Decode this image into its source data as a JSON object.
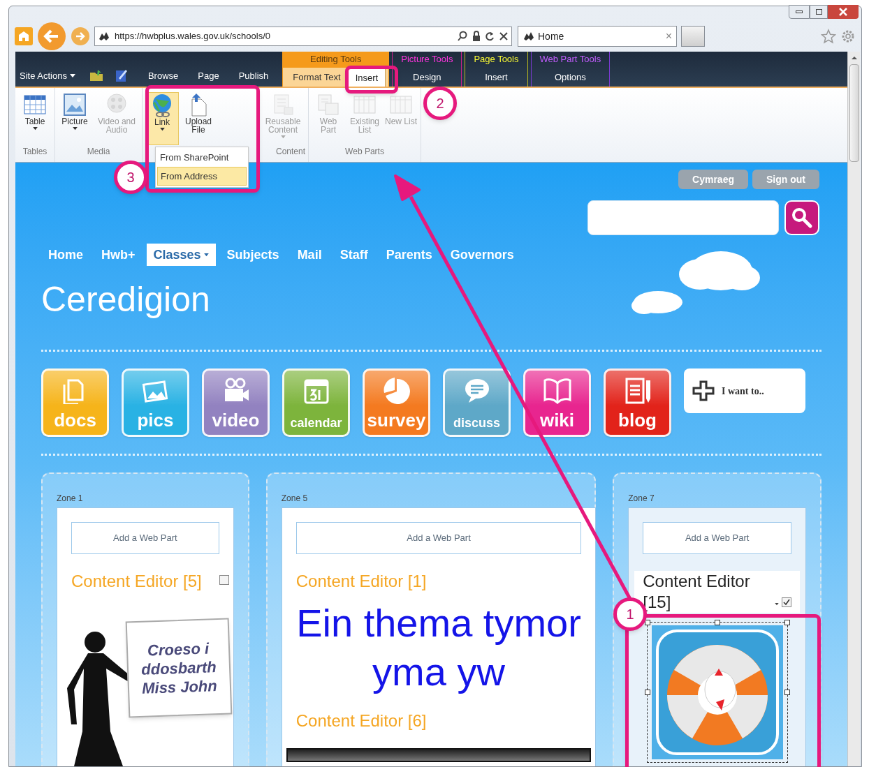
{
  "browser": {
    "address": "https://hwbplus.wales.gov.uk/schools/0",
    "tab": {
      "title": "Home",
      "close": "×"
    }
  },
  "ribbon": {
    "site_actions": "Site Actions",
    "tabs": [
      {
        "label": "Browse",
        "selected": false
      },
      {
        "label": "Page",
        "selected": false
      },
      {
        "label": "Publish",
        "selected": false
      }
    ],
    "contextual_groups": [
      {
        "title": "Editing Tools",
        "color": "#f59a1b",
        "active": true,
        "tabs": [
          {
            "label": "Format Text",
            "selected": false
          },
          {
            "label": "Insert",
            "selected": true
          }
        ]
      },
      {
        "title": "Picture Tools",
        "color": "#c8208c",
        "active": false,
        "tabs": [
          {
            "label": "Design",
            "selected": false
          }
        ]
      },
      {
        "title": "Page Tools",
        "color": "#b8b820",
        "active": false,
        "tabs": [
          {
            "label": "Insert",
            "selected": false
          }
        ]
      },
      {
        "title": "Web Part Tools",
        "color": "#7a3ad0",
        "active": false,
        "tabs": [
          {
            "label": "Options",
            "selected": false
          }
        ]
      }
    ],
    "groups": [
      {
        "label": "Tables",
        "buttons": [
          {
            "kind": "table",
            "label": "Table",
            "disabled": false,
            "dropdown": true,
            "pressed": false
          }
        ]
      },
      {
        "label": "Media",
        "buttons": [
          {
            "kind": "picture",
            "label": "Picture",
            "disabled": false,
            "dropdown": true,
            "pressed": false
          },
          {
            "kind": "video",
            "label": "Video and Audio",
            "disabled": true,
            "dropdown": false,
            "pressed": false
          }
        ]
      },
      {
        "buttons": [
          {
            "kind": "link",
            "label": "Link",
            "disabled": false,
            "dropdown": true,
            "pressed": true
          },
          {
            "kind": "upload",
            "label": "Upload File",
            "disabled": false,
            "dropdown": false,
            "pressed": false
          }
        ]
      },
      {
        "label": "Content",
        "buttons": [
          {
            "kind": "reusable",
            "label": "Reusable Content",
            "disabled": true,
            "dropdown": true,
            "pressed": false
          }
        ]
      },
      {
        "label": "Web Parts",
        "buttons": [
          {
            "kind": "webpart",
            "label": "Web Part",
            "disabled": true,
            "dropdown": false,
            "pressed": false
          },
          {
            "kind": "list",
            "label": "Existing List",
            "disabled": true,
            "dropdown": false,
            "pressed": false
          },
          {
            "kind": "list",
            "label": "New List",
            "disabled": true,
            "dropdown": false,
            "pressed": false
          }
        ]
      }
    ],
    "link_menu": [
      {
        "label": "From SharePoint",
        "highlighted": false
      },
      {
        "label": "From Address",
        "highlighted": true
      }
    ]
  },
  "page": {
    "header_buttons": [
      "Cymraeg",
      "Sign out"
    ],
    "nav": [
      {
        "label": "Home",
        "selected": false,
        "dropdown": false
      },
      {
        "label": "Hwb+",
        "selected": false,
        "dropdown": false
      },
      {
        "label": "Classes",
        "selected": true,
        "dropdown": true
      },
      {
        "label": "Subjects",
        "selected": false,
        "dropdown": false
      },
      {
        "label": "Mail",
        "selected": false,
        "dropdown": false
      },
      {
        "label": "Staff",
        "selected": false,
        "dropdown": false
      },
      {
        "label": "Parents",
        "selected": false,
        "dropdown": false
      },
      {
        "label": "Governors",
        "selected": false,
        "dropdown": false
      }
    ],
    "title": "Ceredigion",
    "tiles": [
      {
        "label": "docs",
        "kind": "docs",
        "color": "#f6b41a"
      },
      {
        "label": "pics",
        "kind": "pics",
        "color": "#29b2e4"
      },
      {
        "label": "video",
        "kind": "video",
        "color": "#9282c0"
      },
      {
        "label": "calendar",
        "kind": "calendar",
        "color": "#7db43c"
      },
      {
        "label": "survey",
        "kind": "survey",
        "color": "#f47a20"
      },
      {
        "label": "discuss",
        "kind": "discuss",
        "color": "#5ea8c8"
      },
      {
        "label": "wiki",
        "kind": "wiki",
        "color": "#e8258f"
      },
      {
        "label": "blog",
        "kind": "blog",
        "color": "#e2231a"
      }
    ],
    "i_want_to": "I want to..",
    "zones": [
      {
        "title": "Zone 1",
        "add": "Add a Web Part",
        "parts": [
          {
            "title": "Content Editor [5]",
            "kind": "sign",
            "checked": false,
            "sign": "Croeso i ddosbarth Miss John"
          }
        ]
      },
      {
        "title": "Zone 5",
        "add": "Add a Web Part",
        "parts": [
          {
            "title": "Content Editor [1]",
            "kind": "heading",
            "heading": "Ein thema tymor yma yw"
          },
          {
            "title": "Content Editor [6]",
            "kind": "picture"
          }
        ]
      },
      {
        "title": "Zone 7",
        "add": "Add a Web Part",
        "parts": [
          {
            "title": "Content Editor [15]",
            "kind": "image",
            "checked": true,
            "dropdown": true,
            "selected": true
          }
        ]
      }
    ]
  },
  "annotations": [
    {
      "number": "1"
    },
    {
      "number": "2"
    },
    {
      "number": "3"
    }
  ]
}
